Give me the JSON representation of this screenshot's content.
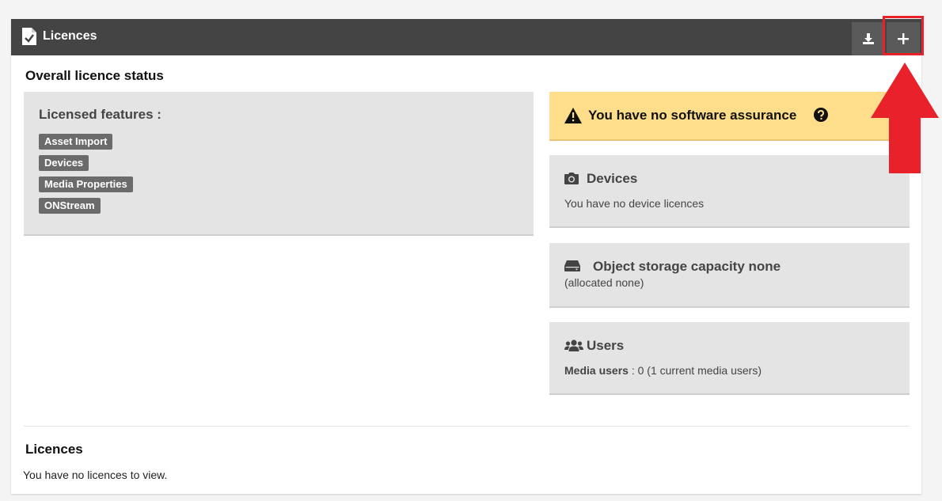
{
  "header": {
    "title": "Licences",
    "download_icon": "download-icon",
    "add_icon": "plus-icon"
  },
  "overall": {
    "title": "Overall licence status",
    "features_title": "Licensed features :",
    "features": [
      "Asset Import",
      "Devices",
      "Media Properties",
      "ONStream"
    ]
  },
  "warning": {
    "text": "You have no software assurance"
  },
  "devices": {
    "title": "Devices",
    "text": "You have no device licences"
  },
  "storage": {
    "title": "Object storage capacity none",
    "text": "(allocated none)"
  },
  "users": {
    "title": "Users",
    "label": "Media users",
    "text": " : 0 (1 current media users)"
  },
  "licences": {
    "title": "Licences",
    "text": "You have no licences to view."
  },
  "colors": {
    "header_bg": "#444444",
    "warning_bg": "#fede8a",
    "highlight_red": "#e8212a",
    "tag_bg": "#6b6b6b"
  }
}
